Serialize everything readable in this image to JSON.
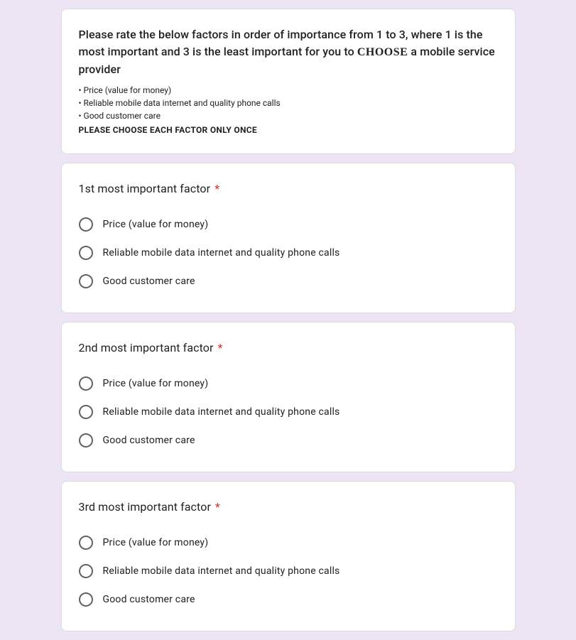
{
  "intro": {
    "title_pre": "Please rate the below factors in order of importance from 1 to 3, where 1 is the most important and 3 is the least important for you to ",
    "title_choose": "CHOOSE",
    "title_post": " a mobile service provider",
    "bullets": [
      "• Price (value for money)",
      "• Reliable mobile data internet and quality phone calls",
      "• Good customer care"
    ],
    "strong_note": "PLEASE CHOOSE EACH FACTOR ONLY ONCE"
  },
  "required_mark": "*",
  "questions": [
    {
      "title": "1st most important factor",
      "required": true,
      "options": [
        "Price (value for money)",
        "Reliable mobile data internet and quality phone calls",
        "Good customer care"
      ]
    },
    {
      "title": "2nd most important factor",
      "required": true,
      "options": [
        "Price (value for money)",
        "Reliable mobile data internet and quality phone calls",
        "Good customer care"
      ]
    },
    {
      "title": "3rd most important factor",
      "required": true,
      "options": [
        "Price (value for money)",
        "Reliable mobile data internet and quality phone calls",
        "Good customer care"
      ]
    }
  ]
}
